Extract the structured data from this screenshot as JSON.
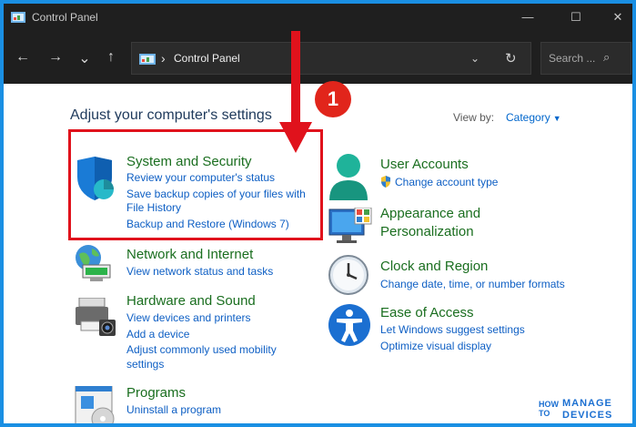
{
  "window": {
    "title": "Control Panel",
    "minimize": "—",
    "maximize": "☐",
    "close": "✕"
  },
  "nav": {
    "back": "←",
    "forward": "→",
    "recent": "⌄",
    "up": "↑",
    "breadcrumb_sep": "›",
    "breadcrumb": "Control Panel",
    "address_dropdown": "⌄",
    "refresh": "↻",
    "search_placeholder": "Search ...",
    "search_icon": "⌕"
  },
  "heading": "Adjust your computer's settings",
  "view_by": {
    "label": "View by:",
    "value": "Category",
    "caret": "▼"
  },
  "annotation": {
    "badge": "1"
  },
  "categories": {
    "system_security": {
      "title": "System and Security",
      "links": [
        "Review your computer's status",
        "Save backup copies of your files with",
        "File History",
        "Backup and Restore (Windows 7)"
      ]
    },
    "network": {
      "title": "Network and Internet",
      "links": [
        "View network status and tasks"
      ]
    },
    "hardware": {
      "title": "Hardware and Sound",
      "links": [
        "View devices and printers",
        "Add a device",
        "Adjust commonly used mobility",
        "settings"
      ]
    },
    "programs": {
      "title": "Programs",
      "links": [
        "Uninstall a program"
      ]
    },
    "user_accounts": {
      "title": "User Accounts",
      "links": [
        "Change account type"
      ]
    },
    "appearance": {
      "title": "Appearance and",
      "title2": "Personalization"
    },
    "clock": {
      "title": "Clock and Region",
      "links": [
        "Change date, time, or number formats"
      ]
    },
    "ease": {
      "title": "Ease of Access",
      "links": [
        "Let Windows suggest settings",
        "Optimize visual display"
      ]
    }
  },
  "brand": {
    "line1a": "HOW",
    "line1b": "TO",
    "manage": "MANAGE",
    "devices": "DEVICES"
  }
}
